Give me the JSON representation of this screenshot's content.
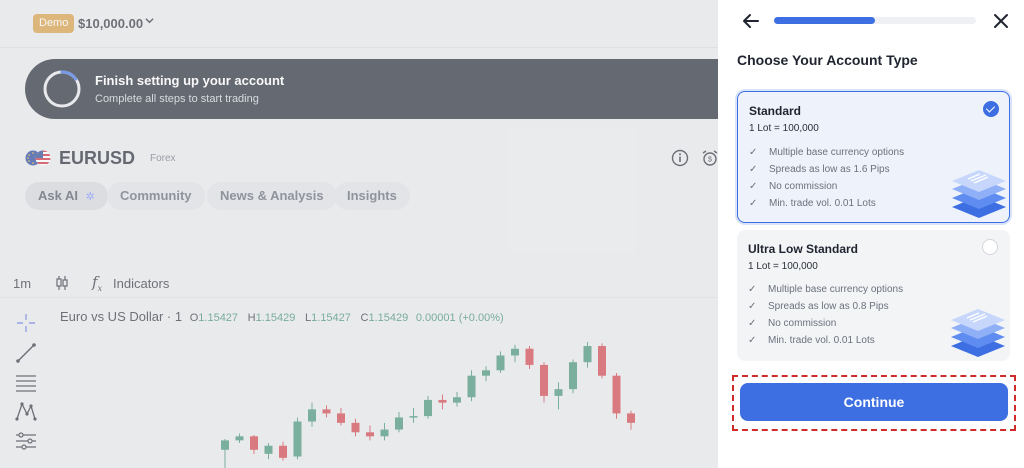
{
  "header": {
    "demo_badge": "Demo",
    "balance": "$10,000.00"
  },
  "setup_banner": {
    "title": "Finish setting up your account",
    "subtitle": "Complete all steps to start trading",
    "progress_fraction": 0.15
  },
  "instrument": {
    "symbol": "EURUSD",
    "category": "Forex"
  },
  "tabs": [
    {
      "label": "Ask AI"
    },
    {
      "label": "Community"
    },
    {
      "label": "News & Analysis"
    },
    {
      "label": "Insights"
    }
  ],
  "chart_toolbar": {
    "timeframe": "1m",
    "indicators_label": "Indicators"
  },
  "ohlc": {
    "name": "Euro vs US Dollar · 1",
    "o_label": "O",
    "o": "1.15427",
    "h_label": "H",
    "h": "1.15429",
    "l_label": "L",
    "l": "1.15427",
    "c_label": "C",
    "c": "1.15429",
    "change": "0.00001 (+0.00%)"
  },
  "chart_data": {
    "type": "candlestick",
    "candles": [
      {
        "o": 1.1525,
        "h": 1.1533,
        "l": 1.151,
        "c": 1.1532
      },
      {
        "o": 1.1532,
        "h": 1.1537,
        "l": 1.153,
        "c": 1.1535
      },
      {
        "o": 1.1535,
        "h": 1.1536,
        "l": 1.1522,
        "c": 1.1525
      },
      {
        "o": 1.1522,
        "h": 1.153,
        "l": 1.1518,
        "c": 1.1528
      },
      {
        "o": 1.1528,
        "h": 1.1531,
        "l": 1.1517,
        "c": 1.1519
      },
      {
        "o": 1.152,
        "h": 1.1549,
        "l": 1.1518,
        "c": 1.1546
      },
      {
        "o": 1.1546,
        "h": 1.156,
        "l": 1.1542,
        "c": 1.1555
      },
      {
        "o": 1.1555,
        "h": 1.1558,
        "l": 1.1549,
        "c": 1.1552
      },
      {
        "o": 1.1552,
        "h": 1.1556,
        "l": 1.1543,
        "c": 1.1545
      },
      {
        "o": 1.1545,
        "h": 1.1548,
        "l": 1.1535,
        "c": 1.1538
      },
      {
        "o": 1.1538,
        "h": 1.1543,
        "l": 1.1532,
        "c": 1.1535
      },
      {
        "o": 1.1535,
        "h": 1.1545,
        "l": 1.1532,
        "c": 1.154
      },
      {
        "o": 1.154,
        "h": 1.1553,
        "l": 1.1538,
        "c": 1.1549
      },
      {
        "o": 1.1549,
        "h": 1.1556,
        "l": 1.1545,
        "c": 1.155
      },
      {
        "o": 1.155,
        "h": 1.1565,
        "l": 1.1548,
        "c": 1.1562
      },
      {
        "o": 1.1562,
        "h": 1.1566,
        "l": 1.1555,
        "c": 1.156
      },
      {
        "o": 1.156,
        "h": 1.1568,
        "l": 1.1557,
        "c": 1.1564
      },
      {
        "o": 1.1564,
        "h": 1.1584,
        "l": 1.1561,
        "c": 1.158
      },
      {
        "o": 1.158,
        "h": 1.1587,
        "l": 1.1576,
        "c": 1.1584
      },
      {
        "o": 1.1584,
        "h": 1.1598,
        "l": 1.1582,
        "c": 1.1595
      },
      {
        "o": 1.1595,
        "h": 1.1603,
        "l": 1.159,
        "c": 1.16
      },
      {
        "o": 1.16,
        "h": 1.1602,
        "l": 1.1585,
        "c": 1.1588
      },
      {
        "o": 1.1588,
        "h": 1.159,
        "l": 1.156,
        "c": 1.1565
      },
      {
        "o": 1.1565,
        "h": 1.1575,
        "l": 1.1555,
        "c": 1.157
      },
      {
        "o": 1.157,
        "h": 1.1592,
        "l": 1.1567,
        "c": 1.159
      },
      {
        "o": 1.159,
        "h": 1.1605,
        "l": 1.1586,
        "c": 1.1602
      },
      {
        "o": 1.1602,
        "h": 1.1604,
        "l": 1.1578,
        "c": 1.158
      },
      {
        "o": 1.158,
        "h": 1.1582,
        "l": 1.1548,
        "c": 1.1552
      },
      {
        "o": 1.1552,
        "h": 1.1554,
        "l": 1.154,
        "c": 1.1545
      }
    ]
  },
  "drawer": {
    "progress_fraction": 0.5,
    "title": "Choose Your Account Type",
    "accounts": [
      {
        "name": "Standard",
        "lot": "1 Lot = 100,000",
        "selected": true,
        "features": [
          "Multiple base currency options",
          "Spreads as low as 1.6 Pips",
          "No commission",
          "Min. trade vol. 0.01 Lots"
        ]
      },
      {
        "name": "Ultra Low Standard",
        "lot": "1 Lot = 100,000",
        "selected": false,
        "features": [
          "Multiple base currency options",
          "Spreads as low as 0.8 Pips",
          "No commission",
          "Min. trade vol. 0.01 Lots"
        ]
      }
    ],
    "continue_label": "Continue"
  },
  "colors": {
    "accent": "#3d6fe3",
    "bull": "#3f8f72",
    "bear": "#cf3d46",
    "highlight": "#cf2b2b"
  }
}
